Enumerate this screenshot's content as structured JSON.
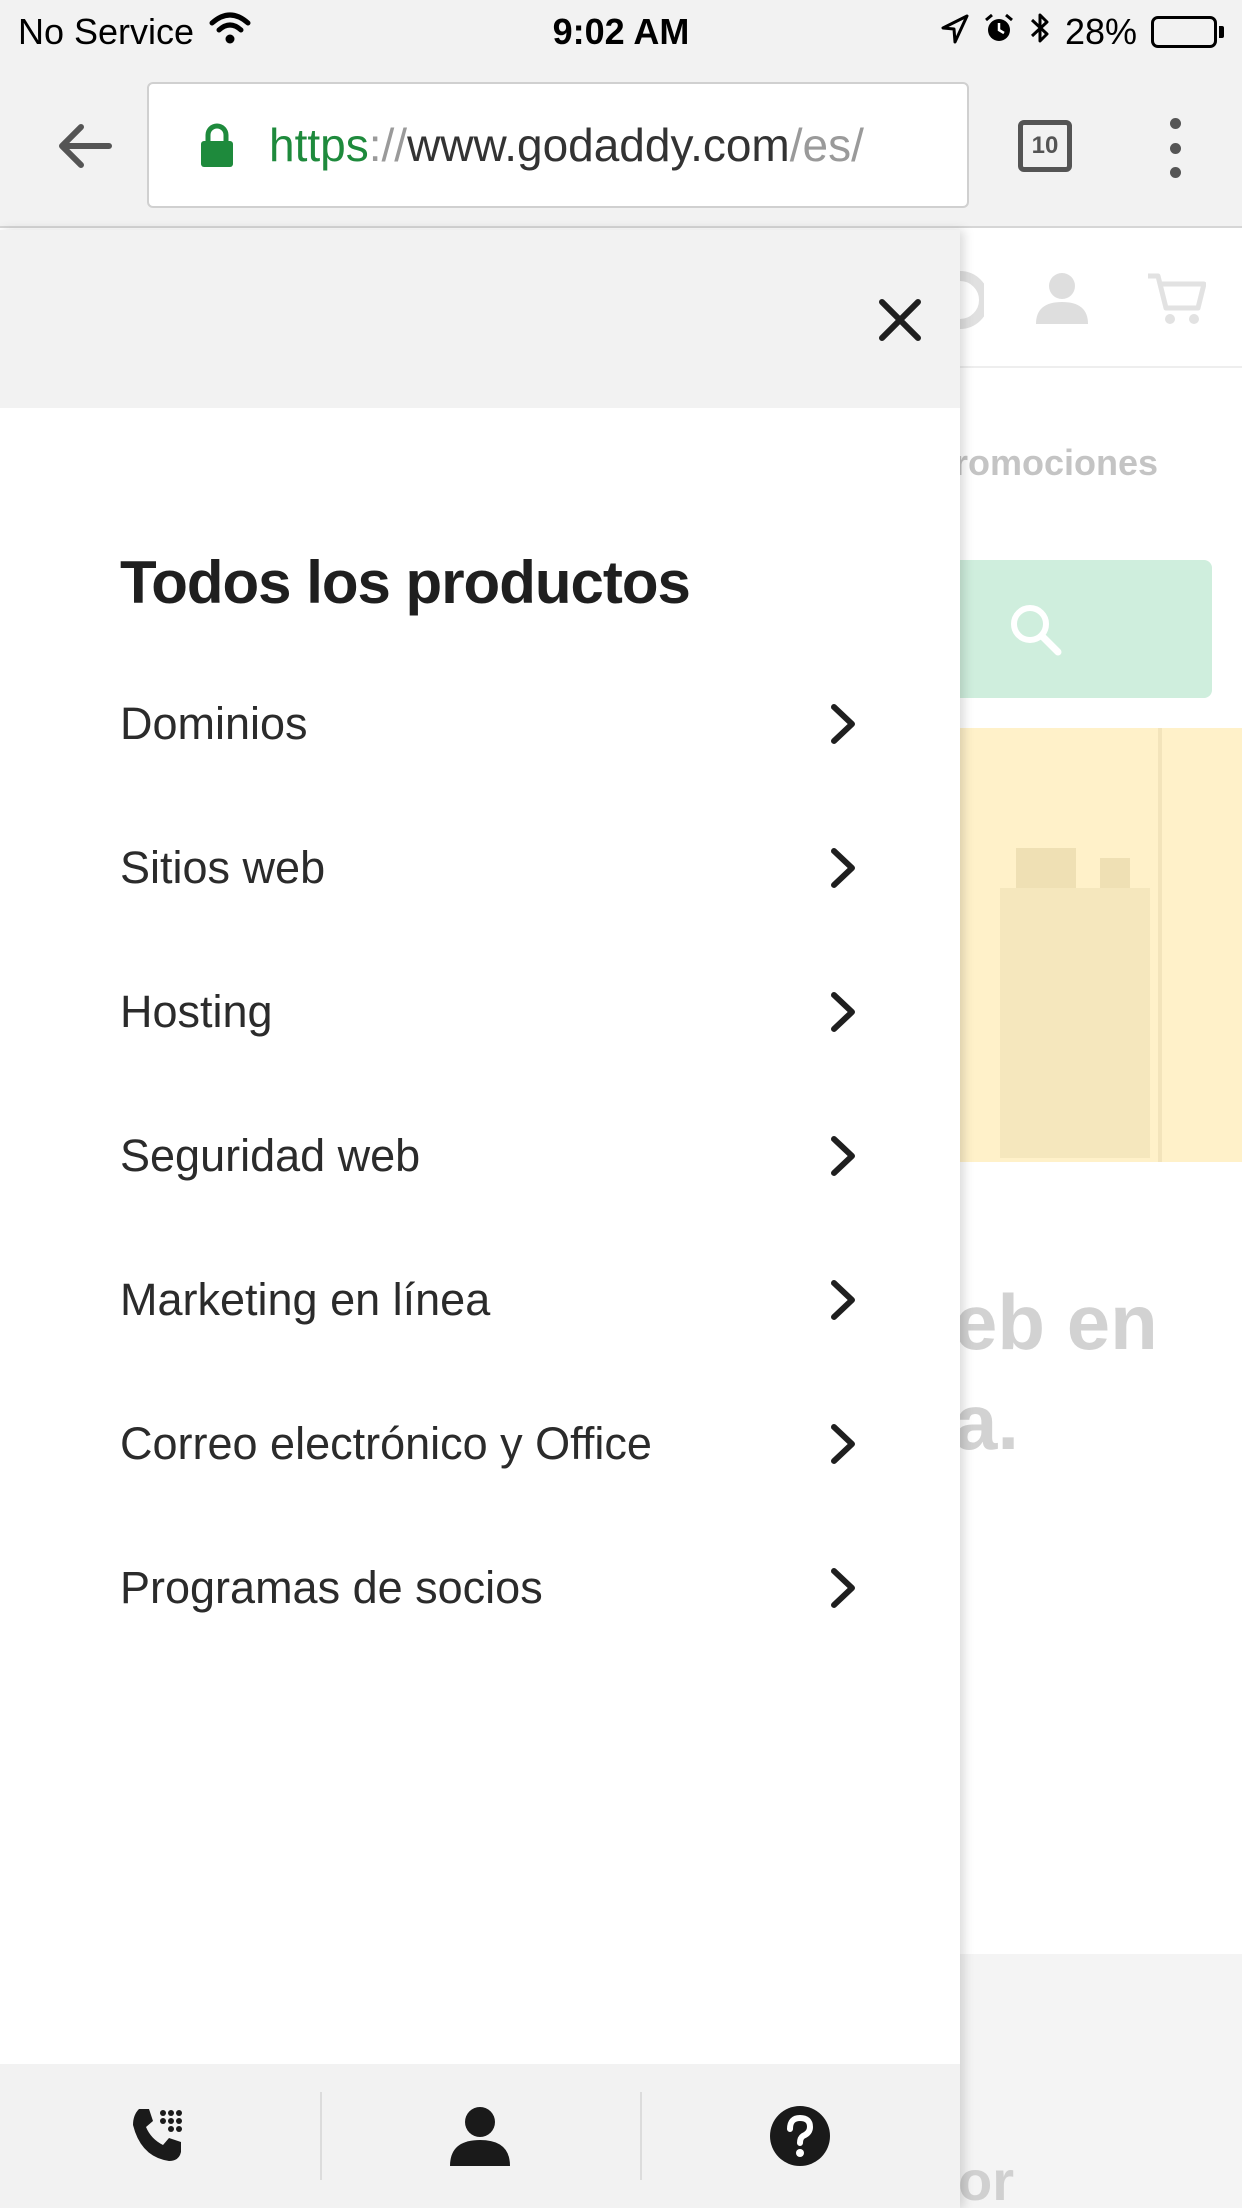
{
  "status_bar": {
    "carrier": "No Service",
    "time": "9:02 AM",
    "battery": "28%",
    "battery_level": 0.28,
    "icons": [
      "wifi-icon",
      "location-arrow-icon",
      "alarm-icon",
      "bluetooth-icon",
      "battery-icon"
    ]
  },
  "browser": {
    "url_scheme": "https",
    "url_separator": "://",
    "url_host": "www.godaddy.com",
    "url_path": "/es/",
    "tab_count": "10",
    "icons": [
      "back-arrow-icon",
      "lock-icon",
      "menu-dots-icon"
    ]
  },
  "drawer": {
    "title": "Todos los productos",
    "items": [
      {
        "label": "Dominios"
      },
      {
        "label": "Sitios web"
      },
      {
        "label": "Hosting"
      },
      {
        "label": "Seguridad web"
      },
      {
        "label": "Marketing en línea"
      },
      {
        "label": "Correo electrónico y Office"
      },
      {
        "label": "Programas de socios"
      }
    ],
    "footer_icons": [
      "phone-icon",
      "user-icon",
      "help-icon"
    ]
  },
  "background_page": {
    "promo_text": "romociones",
    "heading_text": "eb en\na.",
    "bottom_text": "or"
  },
  "colors": {
    "url_green": "#1e8a3c",
    "search_tint": "#cfeedd",
    "hero_tint": "#fff1c9",
    "drawer_header": "#f2f2f2"
  }
}
